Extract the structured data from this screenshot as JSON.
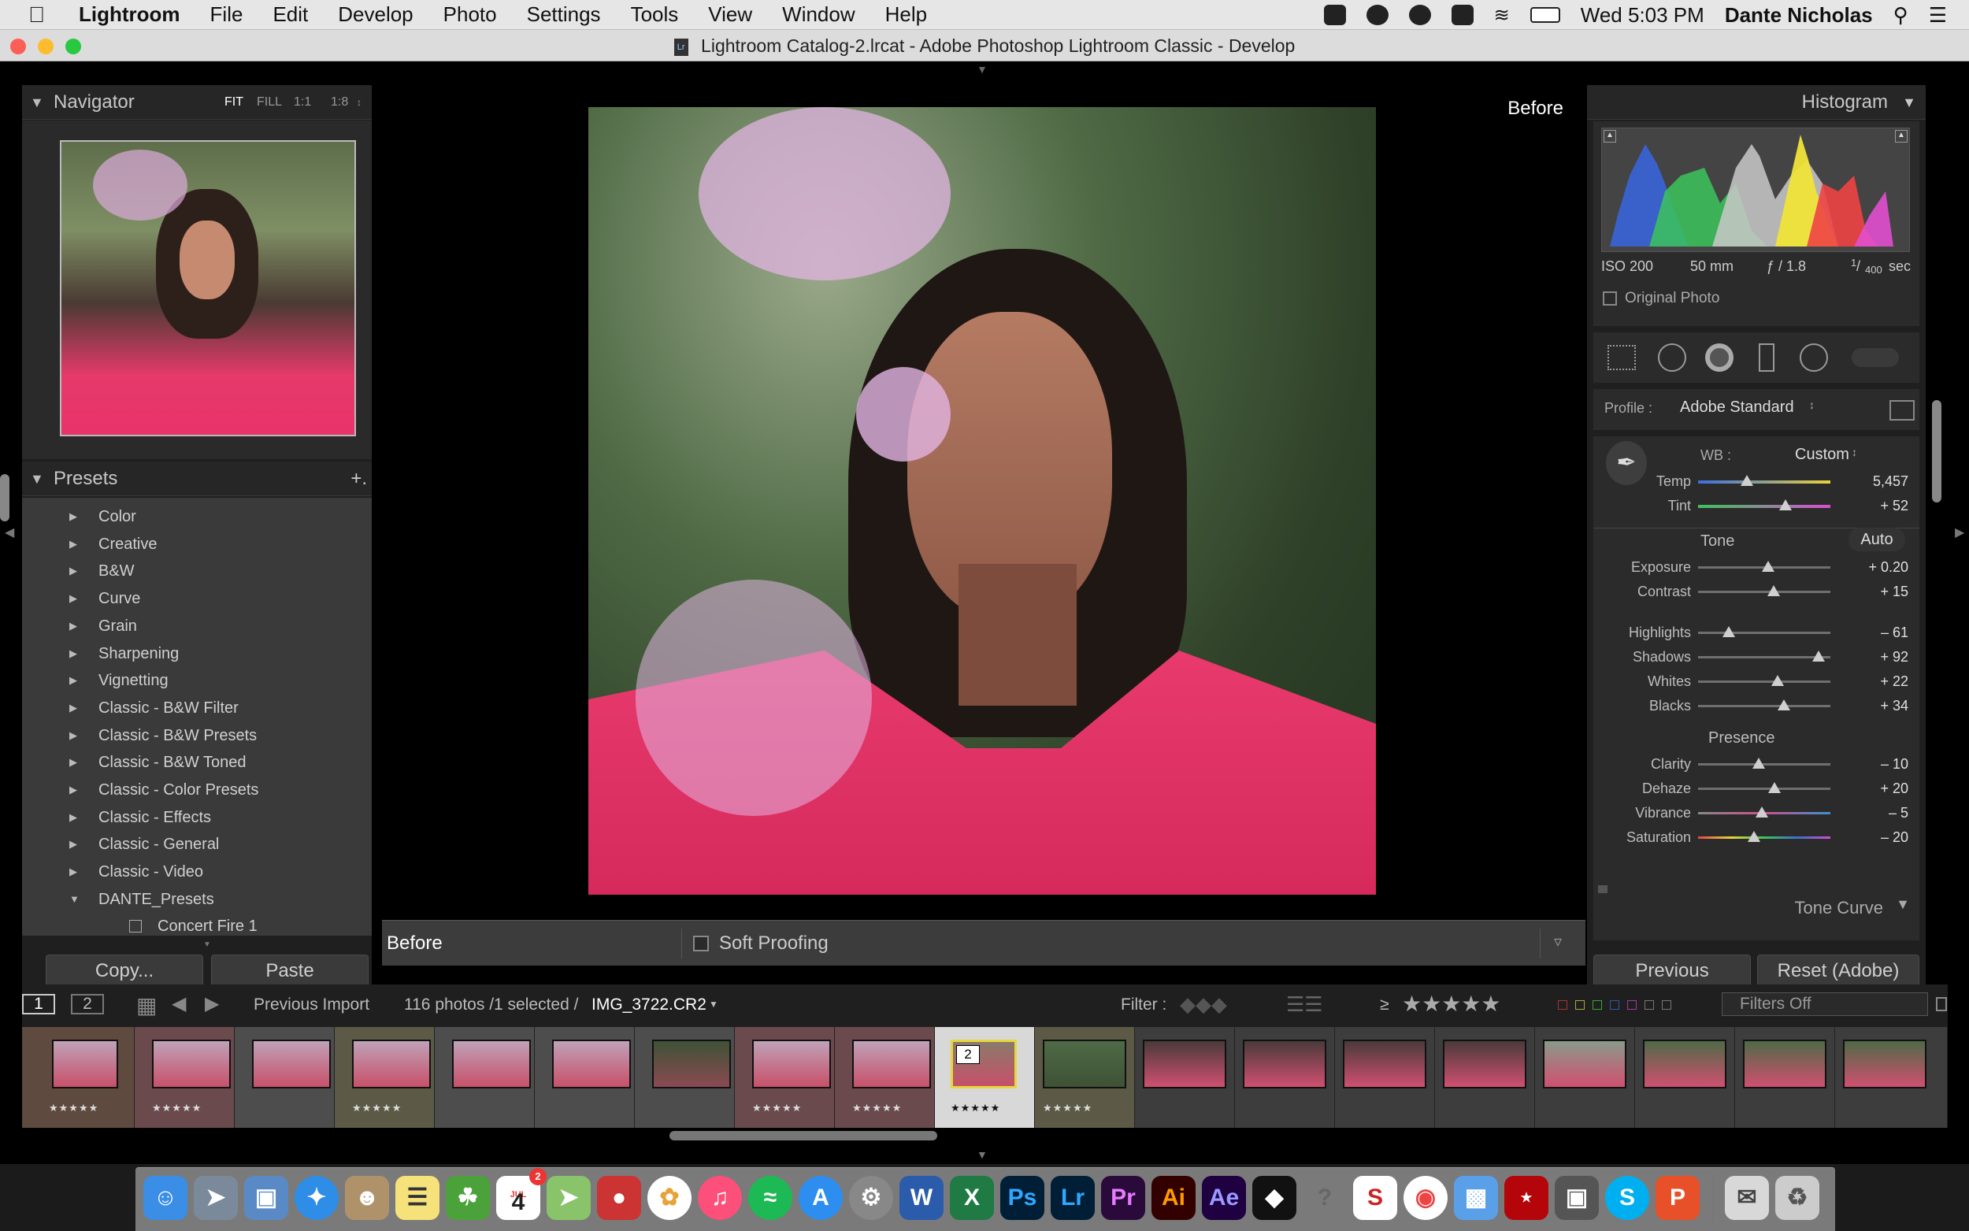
{
  "menubar": {
    "app": "Lightroom",
    "items": [
      "File",
      "Edit",
      "Develop",
      "Photo",
      "Settings",
      "Tools",
      "View",
      "Window",
      "Help"
    ],
    "clock": "Wed 5:03 PM",
    "user": "Dante Nicholas"
  },
  "window": {
    "title": "Lightroom Catalog-2.lrcat - Adobe Photoshop Lightroom Classic - Develop",
    "doc_icon": "Lr"
  },
  "navigator": {
    "title": "Navigator",
    "zoom_options": [
      "FIT",
      "FILL",
      "1:1",
      "1:8"
    ],
    "zoom_selected": "FIT"
  },
  "presets": {
    "title": "Presets",
    "add_label": "+.",
    "items": [
      "Color",
      "Creative",
      "B&W",
      "Curve",
      "Grain",
      "Sharpening",
      "Vignetting",
      "Classic - B&W Filter",
      "Classic - B&W Presets",
      "Classic - B&W Toned",
      "Classic - Color Presets",
      "Classic - Effects",
      "Classic - General",
      "Classic - Video",
      "DANTE_Presets"
    ],
    "subitem": "Concert Fire 1"
  },
  "left_buttons": {
    "copy": "Copy...",
    "paste": "Paste"
  },
  "view": {
    "before_label": "Before"
  },
  "toolbar": {
    "mode": "Before",
    "soft_proofing": "Soft Proofing"
  },
  "histogram": {
    "title": "Histogram",
    "iso": "ISO 200",
    "focal": "50 mm",
    "aperture": "ƒ / 1.8",
    "shutter_num": "1",
    "shutter_den": "400",
    "shutter_unit": "sec",
    "original_photo": "Original Photo"
  },
  "basic": {
    "profile_label": "Profile :",
    "profile_value": "Adobe Standard",
    "wb_label": "WB :",
    "wb_value": "Custom",
    "tone_label": "Tone",
    "auto_label": "Auto",
    "presence_label": "Presence",
    "next_panel": "Tone Curve",
    "sliders": [
      {
        "label": "Temp",
        "value": "5,457",
        "pos": 0.37
      },
      {
        "label": "Tint",
        "value": "+ 52",
        "pos": 0.66
      },
      {
        "label": "Exposure",
        "value": "+ 0.20",
        "pos": 0.53
      },
      {
        "label": "Contrast",
        "value": "+ 15",
        "pos": 0.57
      },
      {
        "label": "Highlights",
        "value": "– 61",
        "pos": 0.23
      },
      {
        "label": "Shadows",
        "value": "+ 92",
        "pos": 0.91
      },
      {
        "label": "Whites",
        "value": "+ 22",
        "pos": 0.6
      },
      {
        "label": "Blacks",
        "value": "+ 34",
        "pos": 0.65
      },
      {
        "label": "Clarity",
        "value": "– 10",
        "pos": 0.46
      },
      {
        "label": "Dehaze",
        "value": "+ 20",
        "pos": 0.58
      },
      {
        "label": "Vibrance",
        "value": "– 5",
        "pos": 0.48
      },
      {
        "label": "Saturation",
        "value": "– 20",
        "pos": 0.42
      }
    ]
  },
  "right_buttons": {
    "previous": "Previous",
    "reset": "Reset (Adobe)"
  },
  "filmbar": {
    "screen1": "1",
    "screen2": "2",
    "source": "Previous Import",
    "count": "116 photos /1 selected /",
    "filename": "IMG_3722.CR2",
    "filter_label": "Filter :",
    "ge": "≥",
    "filters_off": "Filters Off"
  },
  "filmstrip": {
    "selected_number": "2"
  },
  "dock": {
    "calendar_month": "JUL",
    "calendar_day": "4",
    "calendar_badge": "2",
    "apps": [
      "Ps",
      "Lr",
      "Pr",
      "Ai",
      "Ae"
    ]
  }
}
